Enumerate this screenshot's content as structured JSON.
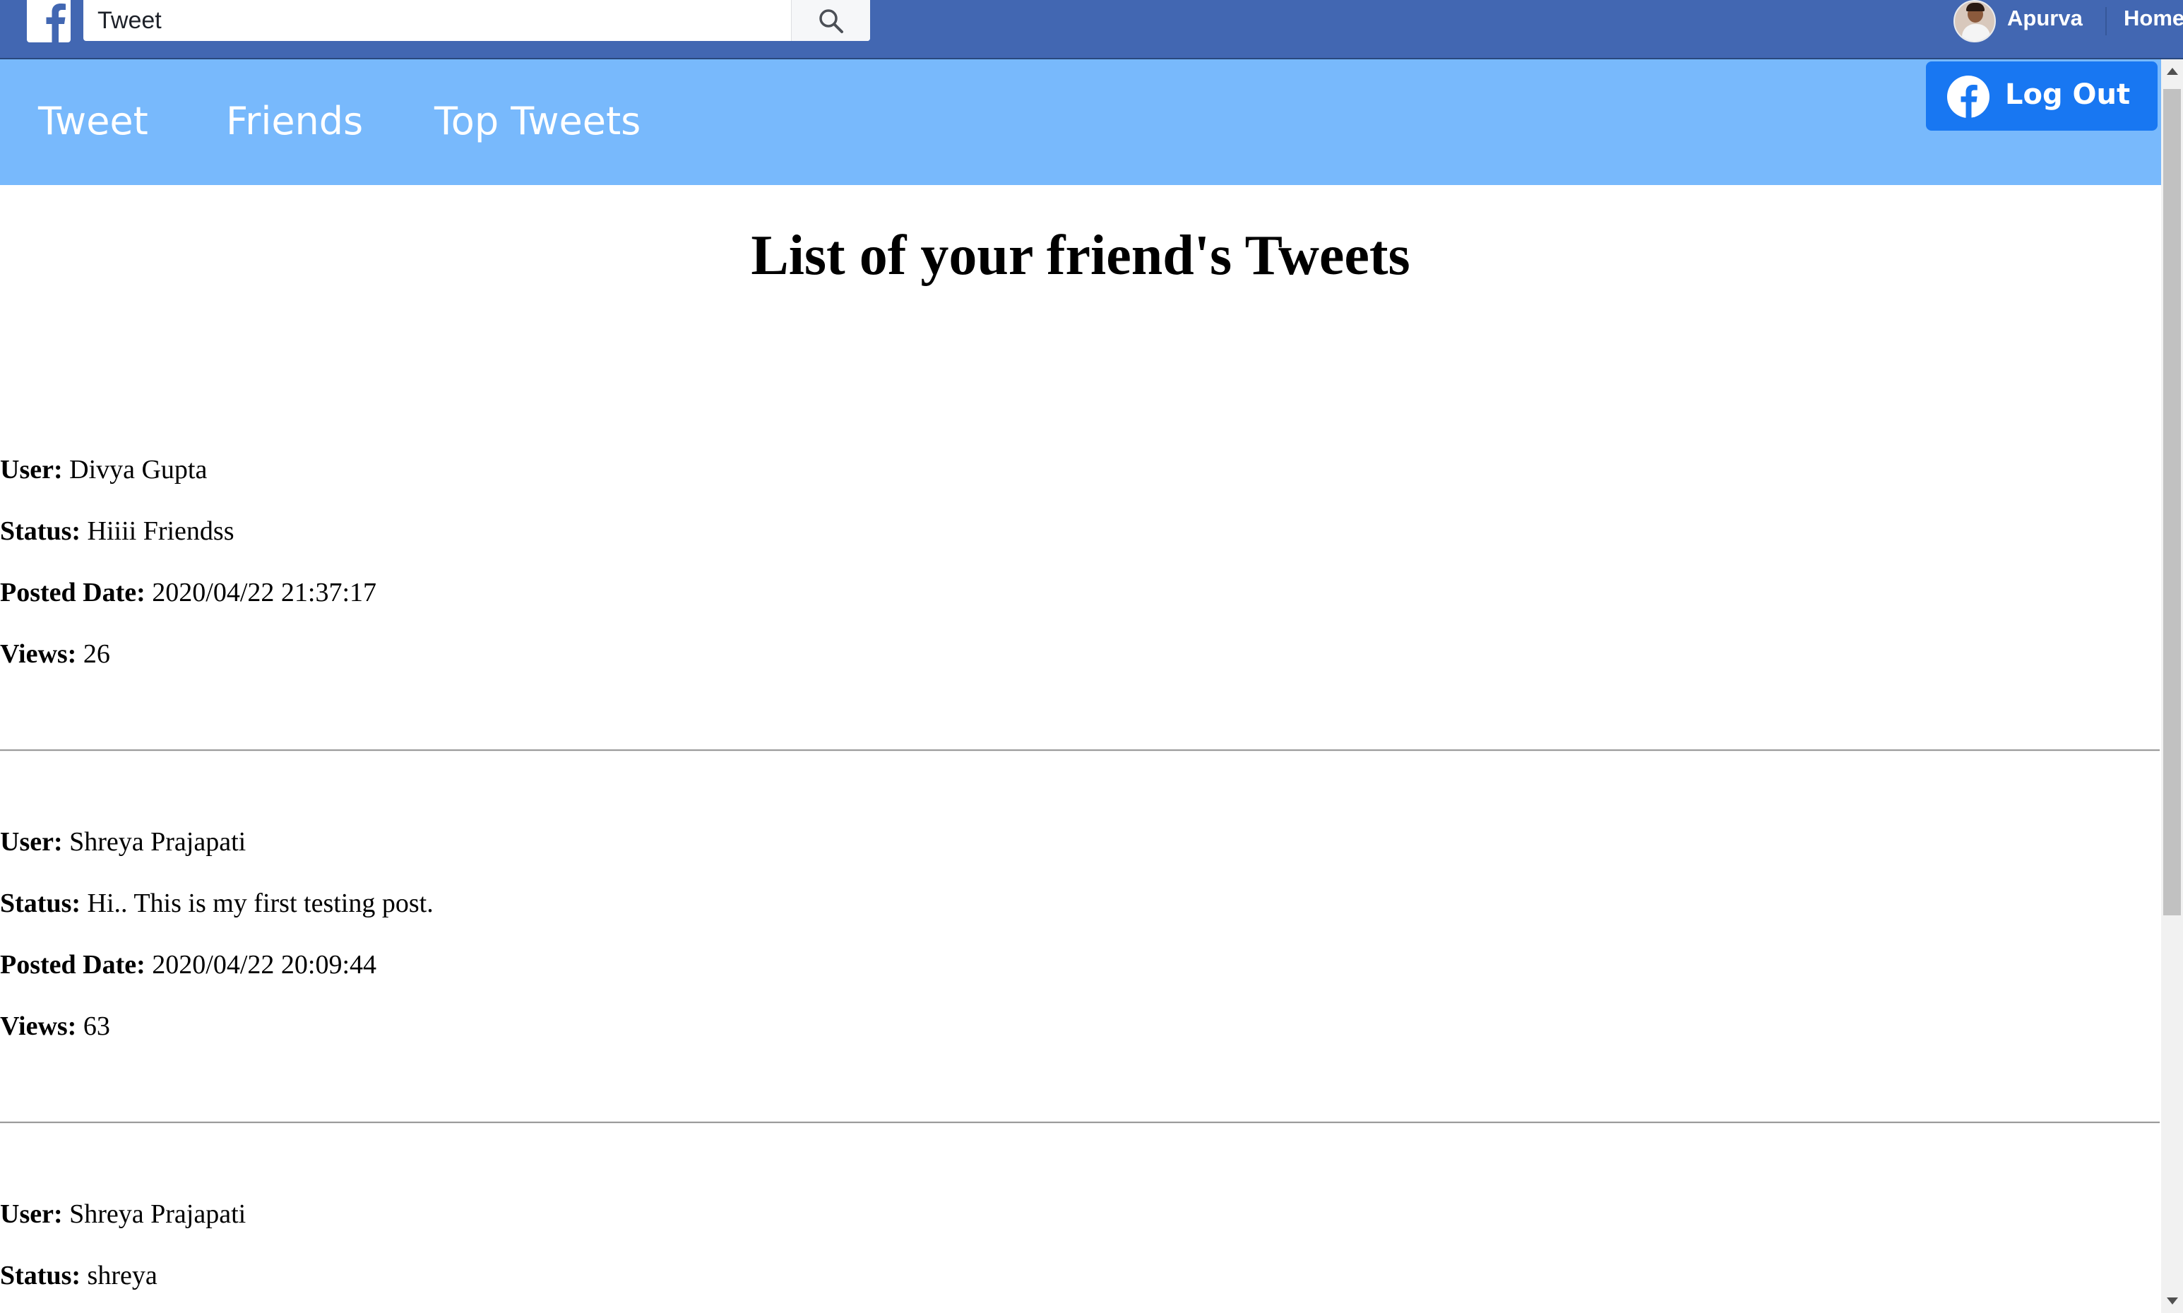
{
  "topbar": {
    "logo_icon": "facebook-f-logo",
    "search": {
      "value": "Tweet",
      "icon": "search-icon"
    },
    "user": {
      "name": "Apurva",
      "avatar": "user-avatar"
    },
    "home_label": "Home",
    "colors": {
      "bar": "#4267b2",
      "text": "#ffffff"
    }
  },
  "navbar": {
    "links": [
      {
        "label": "Tweet"
      },
      {
        "label": "Friends"
      },
      {
        "label": "Top Tweets"
      }
    ],
    "logout": {
      "label": "Log Out",
      "icon": "facebook-circle-icon"
    },
    "colors": {
      "bar": "#78b9fc",
      "logout": "#1877f2"
    }
  },
  "main": {
    "title": "List of your friend's Tweets",
    "field_labels": {
      "user": "User:",
      "status": "Status:",
      "posted_date": "Posted Date:",
      "views": "Views:"
    },
    "tweets": [
      {
        "user": "Divya Gupta",
        "status": "Hiiii Friendss",
        "posted_date": "2020/04/22 21:37:17",
        "views": "26"
      },
      {
        "user": "Shreya Prajapati",
        "status": "Hi.. This is my first testing post.",
        "posted_date": "2020/04/22 20:09:44",
        "views": "63"
      },
      {
        "user": "Shreya Prajapati",
        "status": "shreya"
      }
    ]
  }
}
